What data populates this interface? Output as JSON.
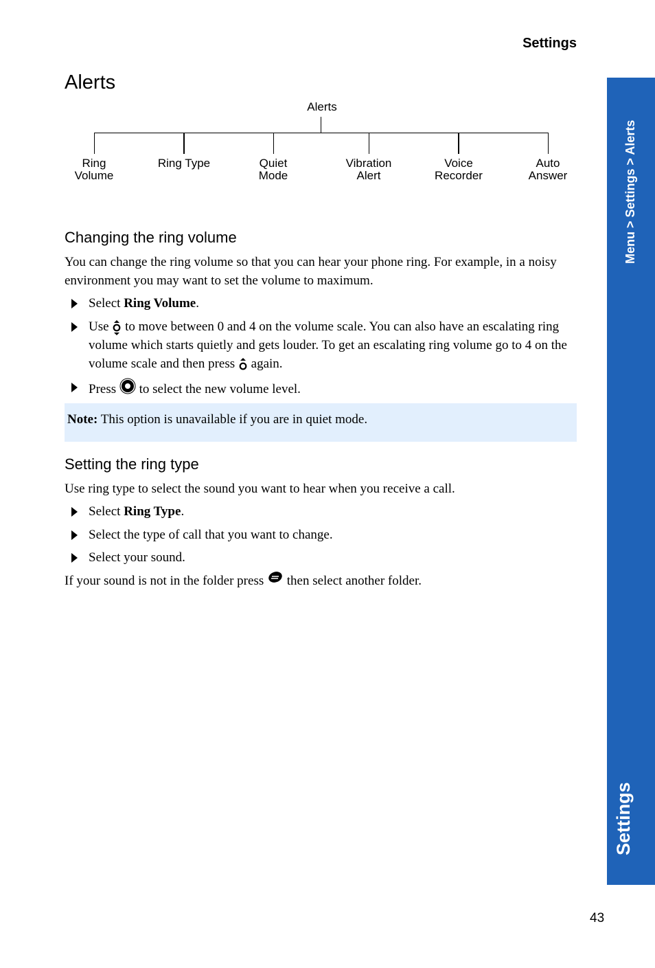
{
  "header": {
    "running_title": "Settings"
  },
  "page": {
    "title": "Alerts",
    "number": "43"
  },
  "diagram": {
    "root": "Alerts",
    "children": [
      {
        "line1": "Ring",
        "line2": "Volume"
      },
      {
        "line1": "Ring Type",
        "line2": ""
      },
      {
        "line1": "Quiet",
        "line2": "Mode"
      },
      {
        "line1": "Vibration",
        "line2": "Alert"
      },
      {
        "line1": "Voice",
        "line2": "Recorder"
      },
      {
        "line1": "Auto",
        "line2": "Answer"
      }
    ]
  },
  "section1": {
    "heading": "Changing the ring volume",
    "intro": "You can change the ring volume so that you can hear your phone ring. For example, in a noisy environment you may want to set the volume to maximum.",
    "step1": {
      "pre": "Select ",
      "bold": "Ring Volume",
      "post": "."
    },
    "step2": {
      "pre": "Use ",
      "icon": "up-down-navigation-key-icon",
      "mid": " to move between 0 and 4 on the volume scale. You can also have an escalating ring volume which starts quietly and gets louder. To get an escalating ring volume go to 4 on the volume scale and then press ",
      "icon2": "up-navigation-key-icon",
      "post": " again."
    },
    "step3": {
      "pre": "Press ",
      "icon": "select-key-icon",
      "post": " to select the new volume level."
    }
  },
  "note": {
    "label": "Note:",
    "text": " This option is unavailable if you are in quiet mode."
  },
  "section2": {
    "heading": "Setting the ring type",
    "intro": "Use ring type to select the sound you want to hear when you receive a call.",
    "step1": {
      "pre": "Select ",
      "bold": "Ring Type",
      "post": "."
    },
    "step2": {
      "text": "Select the type of call that you want to change."
    },
    "step3": {
      "text": "Select your sound."
    },
    "footer": {
      "pre": "If your sound is not in the folder press ",
      "icon": "back-key-icon",
      "post": " then select another folder."
    }
  },
  "side_tab": {
    "breadcrumb": "Menu > Settings > Alerts",
    "section": "Settings",
    "color": "#1f63b8"
  },
  "colors": {
    "note_bg": "#e2effd"
  }
}
